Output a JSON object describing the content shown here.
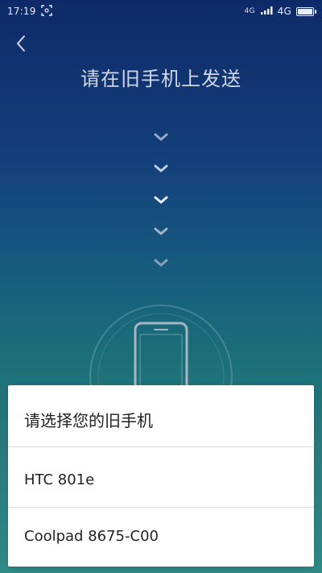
{
  "status_bar": {
    "time": "17:19",
    "sim_label": "4G",
    "network": "4G",
    "battery_level": 1.0
  },
  "icons": {
    "back": "chevron-left-icon",
    "screenshot": "screenshot-icon",
    "signal": "signal-icon",
    "battery": "battery-icon",
    "arrows": "chevron-down-icon",
    "phone": "phone-outline-icon"
  },
  "header": {
    "title": "请在旧手机上发送"
  },
  "sheet": {
    "title": "请选择您的旧手机",
    "options": [
      {
        "label": "HTC 801e"
      },
      {
        "label": "Coolpad 8675-C00"
      }
    ]
  },
  "colors": {
    "background_top": "#0f2a69",
    "background_bottom": "#2f8a86",
    "sheet_bg": "#ffffff",
    "text_primary": "#222222"
  }
}
